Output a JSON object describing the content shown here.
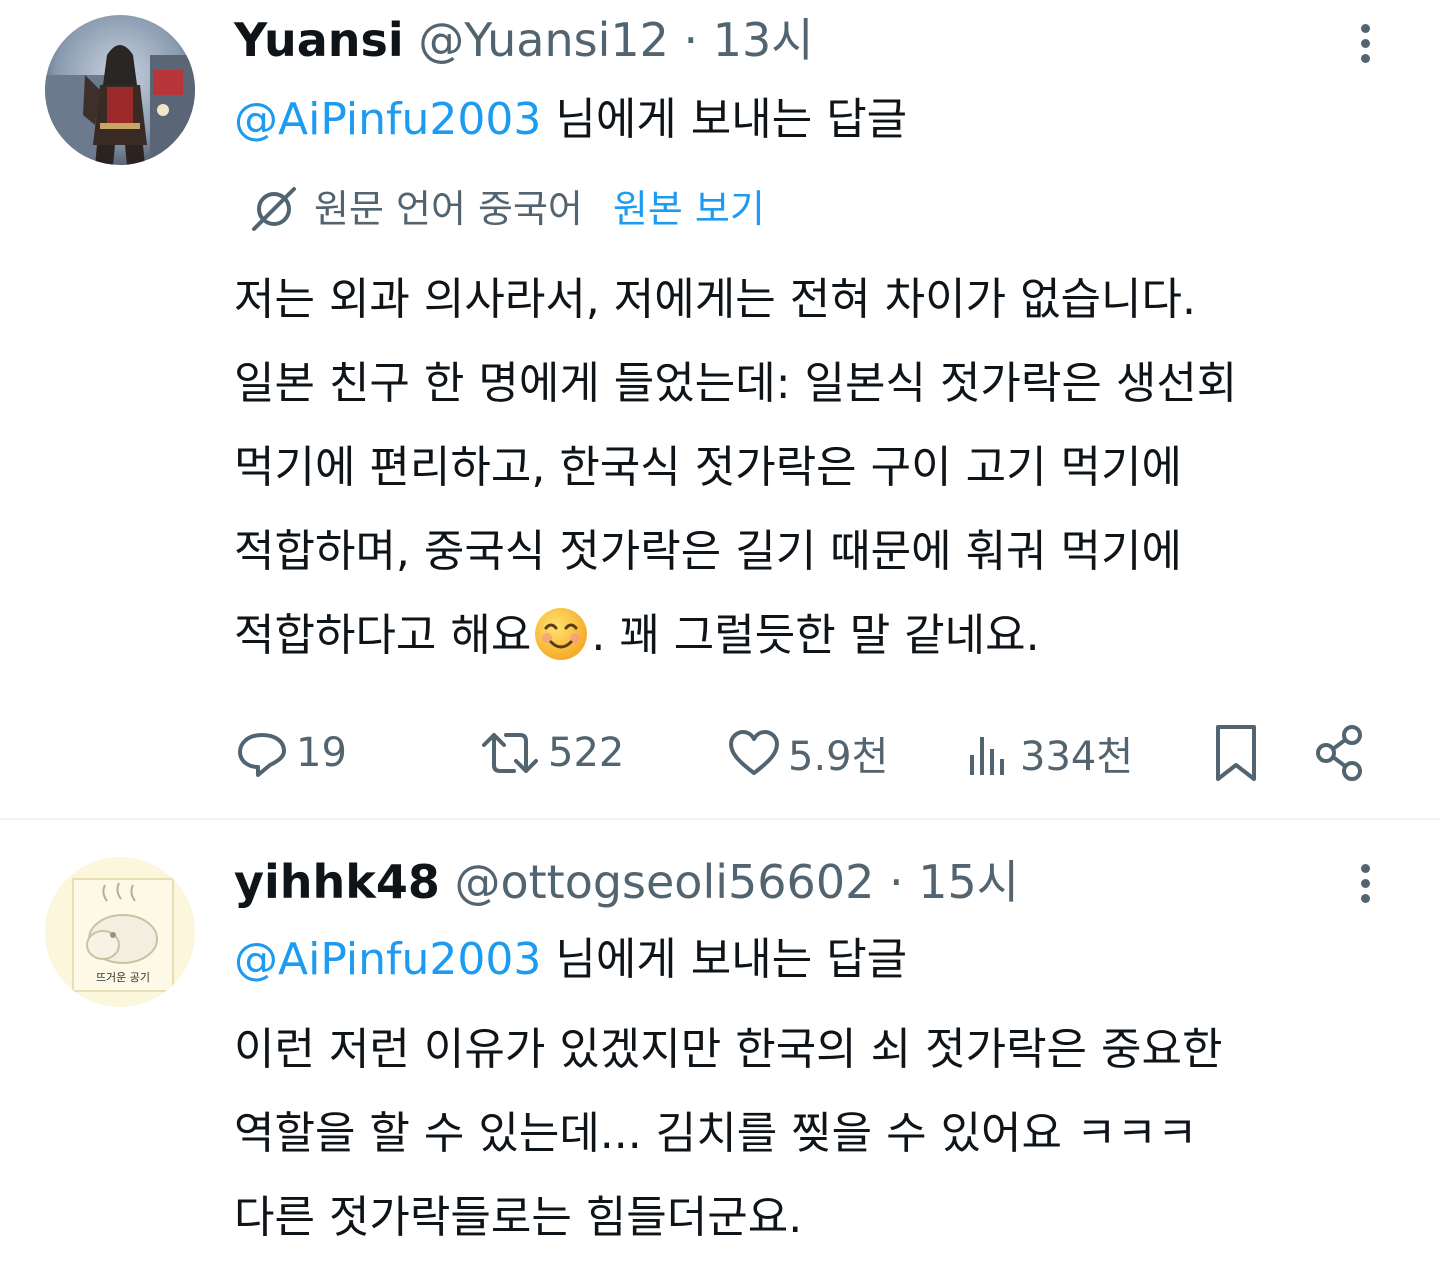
{
  "tweets": [
    {
      "display_name": "Yuansi",
      "handle": "@Yuansi12",
      "separator": "·",
      "time": "13시",
      "reply_to_handle": "@AiPinfu2003",
      "reply_to_suffix": " 님에게 보내는 답글",
      "translation": {
        "source_label": "원문 언어 중국어",
        "show_original": "원본 보기"
      },
      "body_lines": [
        "저는 외과 의사라서, 저에게는 전혀 차이가 없습니다.",
        "일본 친구 한 명에게 들었는데: 일본식 젓가락은 생선회",
        "먹기에 편리하고, 한국식 젓가락은 구이 고기 먹기에",
        "적합하며, 중국식 젓가락은 길기 때문에 훠궈 먹기에"
      ],
      "body_last_before_emoji": "적합하다고 해요",
      "emoji": "smiling-face-emoji",
      "body_last_after_emoji": ". 꽤 그럴듯한 말 같네요.",
      "actions": {
        "replies": "19",
        "retweets": "522",
        "likes": "5.9천",
        "views": "334천"
      },
      "avatar_icon": "assassin-avatar"
    },
    {
      "display_name": "yihhk48",
      "handle": "@ottogseoli56602",
      "separator": "·",
      "time": "15시",
      "reply_to_handle": "@AiPinfu2003",
      "reply_to_suffix": " 님에게 보내는 답글",
      "body_lines": [
        "이런 저런 이유가 있겠지만 한국의 쇠 젓가락은 중요한",
        "역할을 할 수 있는데... 김치를 찢을 수 있어요 ㅋㅋㅋ",
        "다른 젓가락들로는 힘들더군요."
      ],
      "avatar_text": "뜨거운 공기"
    }
  ],
  "colors": {
    "link": "#1d9bf0",
    "secondary_text": "#536471",
    "primary_text": "#0f1419",
    "divider": "#eff3f4"
  },
  "icons": [
    "translate-icon",
    "reply-icon",
    "retweet-icon",
    "like-icon",
    "views-icon",
    "bookmark-icon",
    "share-icon",
    "more-icon"
  ]
}
